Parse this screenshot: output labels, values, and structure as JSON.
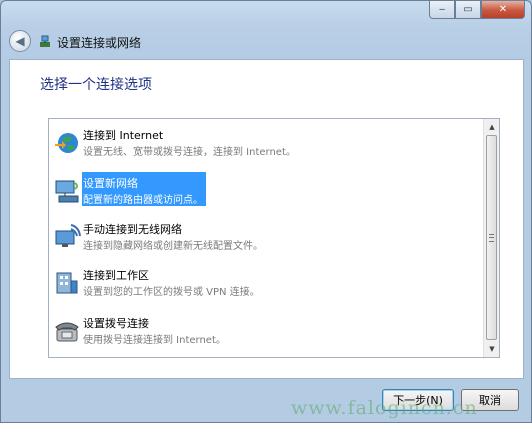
{
  "window": {
    "title": "设置连接或网络",
    "heading": "选择一个连接选项",
    "caption": {
      "minimize_glyph": "‒",
      "maximize_glyph": "▭",
      "close_glyph": "✕"
    }
  },
  "options": [
    {
      "name": "连接到 Internet",
      "desc": "设置无线、宽带或拨号连接，连接到 Internet。",
      "icon": "globe-network-icon",
      "selected": false
    },
    {
      "name": "设置新网络",
      "desc": "配置新的路由器或访问点。",
      "icon": "router-setup-icon",
      "selected": true
    },
    {
      "name": "手动连接到无线网络",
      "desc": "连接到隐藏网络或创建新无线配置文件。",
      "icon": "wireless-monitor-icon",
      "selected": false
    },
    {
      "name": "连接到工作区",
      "desc": "设置到您的工作区的拨号或 VPN 连接。",
      "icon": "workplace-icon",
      "selected": false
    },
    {
      "name": "设置拨号连接",
      "desc": "使用拨号连接连接到 Internet。",
      "icon": "telephone-icon",
      "selected": false
    }
  ],
  "buttons": {
    "next": "下一步(N)",
    "cancel": "取消"
  },
  "watermark": "www.falogincn.cn",
  "colors": {
    "selection": "#3399ff",
    "heading": "#1e3287"
  }
}
